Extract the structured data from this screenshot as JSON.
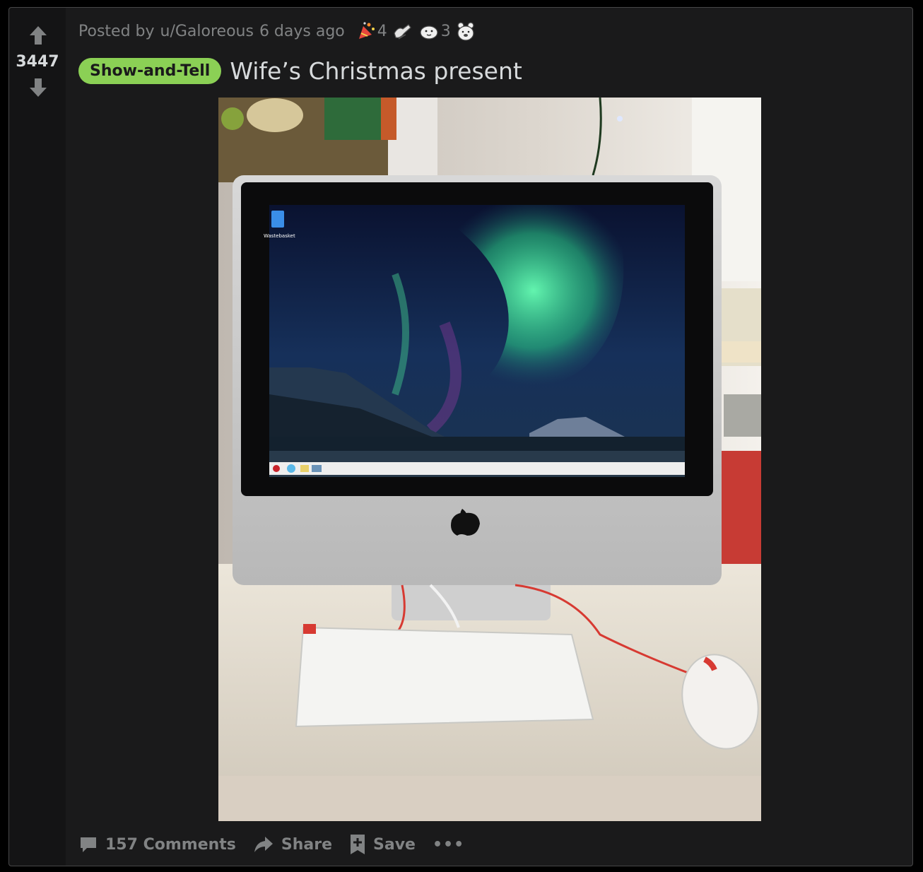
{
  "post": {
    "score": "3447",
    "posted_by_prefix": "Posted by",
    "username": "u/Galoreous",
    "time_ago": "6 days ago",
    "awards": [
      {
        "icon": "party-award-icon",
        "count": "4"
      },
      {
        "icon": "helpful-hands-award-icon",
        "count": ""
      },
      {
        "icon": "wholesome-seal-award-icon",
        "count": "3"
      },
      {
        "icon": "bear-award-icon",
        "count": ""
      }
    ],
    "flair": "Show-and-Tell",
    "title": "Wife’s Christmas present",
    "image": {
      "wastebasket_label": "Wastebasket"
    }
  },
  "actions": {
    "comments": "157 Comments",
    "share": "Share",
    "save": "Save",
    "more": "•••"
  },
  "colors": {
    "card_bg": "#1a1a1b",
    "vote_bg": "#141415",
    "flair_bg": "#8bd055",
    "text": "#d7dadc",
    "muted": "#818384"
  }
}
